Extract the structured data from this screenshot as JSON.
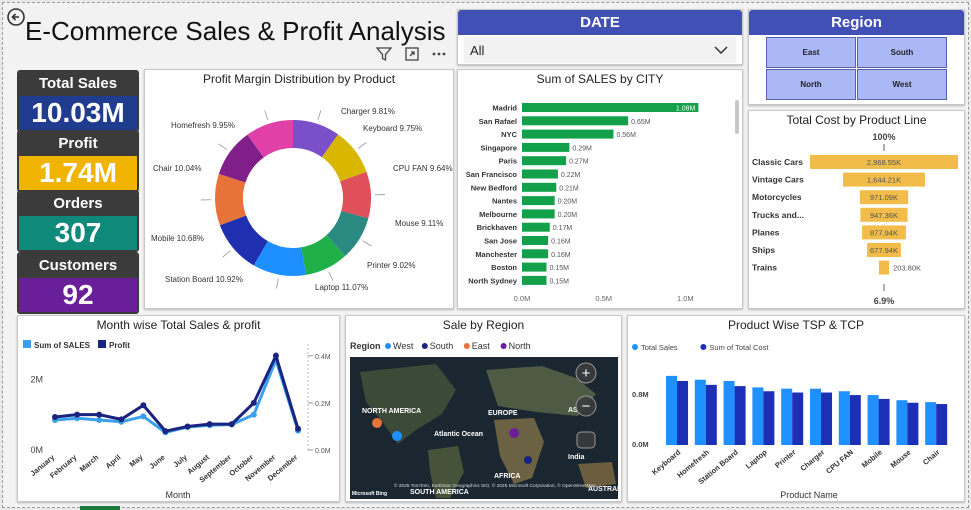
{
  "header": {
    "title": "E-Commerce Sales & Profit Analysis",
    "back_icon": "back-arrow-icon"
  },
  "kpis": [
    {
      "label": "Total Sales",
      "value": "10.03M",
      "color": "#1f3c8f"
    },
    {
      "label": "Profit",
      "value": "1.74M",
      "color": "#f0b400"
    },
    {
      "label": "Orders",
      "value": "307",
      "color": "#0f8a7a"
    },
    {
      "label": "Customers",
      "value": "92",
      "color": "#6a1f9a"
    }
  ],
  "date_slicer": {
    "title": "DATE",
    "selected": "All"
  },
  "region_slicer": {
    "title": "Region",
    "options": [
      "East",
      "South",
      "North",
      "West"
    ]
  },
  "donut": {
    "title": "Profit Margin Distribution by Product",
    "slices": [
      {
        "label": "Charger 9.81%",
        "value": 9.81,
        "color": "#7b4fc9"
      },
      {
        "label": "Keyboard 9.75%",
        "value": 9.75,
        "color": "#d9b600"
      },
      {
        "label": "CPU FAN 9.64%",
        "value": 9.64,
        "color": "#e0505a"
      },
      {
        "label": "Mouse 9.11%",
        "value": 9.11,
        "color": "#2a8a82"
      },
      {
        "label": "Printer 9.02%",
        "value": 9.02,
        "color": "#1fb04a"
      },
      {
        "label": "Laptop 11.07%",
        "value": 11.07,
        "color": "#1e8fff"
      },
      {
        "label": "Station Board 10.92%",
        "value": 10.92,
        "color": "#1f2fb0"
      },
      {
        "label": "Mobile 10.68%",
        "value": 10.68,
        "color": "#e8733a"
      },
      {
        "label": "Chair 10.04%",
        "value": 10.04,
        "color": "#801e8a"
      },
      {
        "label": "Homefresh 9.95%",
        "value": 9.95,
        "color": "#e040a8"
      }
    ]
  },
  "chart_data": [
    {
      "type": "bar",
      "title": "Sum of SALES by CITY",
      "categories": [
        "Madrid",
        "San Rafael",
        "NYC",
        "Singapore",
        "Paris",
        "San Francisco",
        "New Bedford",
        "Nantes",
        "Melbourne",
        "Brickhaven",
        "San Jose",
        "Manchester",
        "Boston",
        "North Sydney"
      ],
      "values": [
        1.08,
        0.65,
        0.56,
        0.29,
        0.27,
        0.22,
        0.21,
        0.2,
        0.2,
        0.17,
        0.16,
        0.16,
        0.15,
        0.15
      ],
      "labels": [
        "1.08M",
        "0.65M",
        "0.56M",
        "0.29M",
        "0.27M",
        "0.22M",
        "0.21M",
        "0.20M",
        "0.20M",
        "0.17M",
        "0.16M",
        "0.16M",
        "0.15M",
        "0.15M"
      ],
      "xticks": [
        "0.0M",
        "0.5M",
        "1.0M"
      ],
      "xlim": [
        0,
        1.2
      ],
      "color": "#12a14a"
    },
    {
      "type": "funnel",
      "title": "Total Cost by Product Line",
      "top_label": "100%",
      "bottom_label": "6.9%",
      "categories": [
        "Classic Cars",
        "Vintage Cars",
        "Motorcycles",
        "Trucks and...",
        "Planes",
        "Ships",
        "Trains"
      ],
      "values": [
        2968.55,
        1644.21,
        971.09,
        947.36,
        877.94,
        677.94,
        203.8
      ],
      "labels": [
        "2,968.55K",
        "1,644.21K",
        "971.09K",
        "947.36K",
        "877.94K",
        "677.94K",
        "203.80K"
      ],
      "color": "#f2bc4a"
    },
    {
      "type": "line",
      "title": "Month wise Total Sales & profit",
      "xlabel": "Month",
      "categories": [
        "January",
        "February",
        "March",
        "April",
        "May",
        "June",
        "July",
        "August",
        "September",
        "October",
        "November",
        "December"
      ],
      "series": [
        {
          "name": "Sum of SALES",
          "values": [
            0.85,
            0.9,
            0.85,
            0.8,
            0.95,
            0.5,
            0.65,
            0.7,
            0.72,
            1.0,
            2.55,
            0.55
          ],
          "color": "#3aa0ee"
        },
        {
          "name": "Profit",
          "values": [
            0.14,
            0.15,
            0.15,
            0.13,
            0.19,
            0.08,
            0.1,
            0.11,
            0.11,
            0.2,
            0.4,
            0.09
          ],
          "color": "#1a237e"
        }
      ],
      "yticks_left": [
        "0M",
        "2M"
      ],
      "yticks_right": [
        "0.0M",
        "0.2M",
        "0.4M"
      ]
    },
    {
      "type": "bar",
      "title": "Product Wise TSP & TCP",
      "xlabel": "Product Name",
      "categories": [
        "Keyboard",
        "Homefresh",
        "Station Board",
        "Laptop",
        "Printer",
        "Charger",
        "CPU FAN",
        "Mobile",
        "Mouse",
        "Chair"
      ],
      "series": [
        {
          "name": "Total Sales",
          "values": [
            1.08,
            1.02,
            1.0,
            0.9,
            0.88,
            0.88,
            0.84,
            0.78,
            0.7,
            0.67
          ],
          "color": "#1e90ff"
        },
        {
          "name": "Sum of Total Cost",
          "values": [
            1.0,
            0.94,
            0.92,
            0.84,
            0.82,
            0.82,
            0.78,
            0.72,
            0.66,
            0.64
          ],
          "color": "#1d2fb5"
        }
      ],
      "yticks": [
        "0.0M",
        "0.8M"
      ],
      "ylim": [
        0,
        1.25
      ]
    }
  ],
  "map": {
    "title": "Sale by Region",
    "legend_title": "Region",
    "legend": [
      {
        "name": "West",
        "color": "#1e90ff"
      },
      {
        "name": "South",
        "color": "#1a237e"
      },
      {
        "name": "East",
        "color": "#e8733a"
      },
      {
        "name": "North",
        "color": "#6a1f9a"
      }
    ],
    "labels": [
      "NORTH AMERICA",
      "EUROPE",
      "Atlantic Ocean",
      "AFRICA",
      "SOUTH AMERICA",
      "India",
      "AS",
      "AUSTRAL"
    ],
    "brand": "Microsoft Bing",
    "copyright": "© 2025 TomTom, Earthstar Geographics SIO, © 2025 Microsoft Corporation, © OpenStreetMap"
  }
}
